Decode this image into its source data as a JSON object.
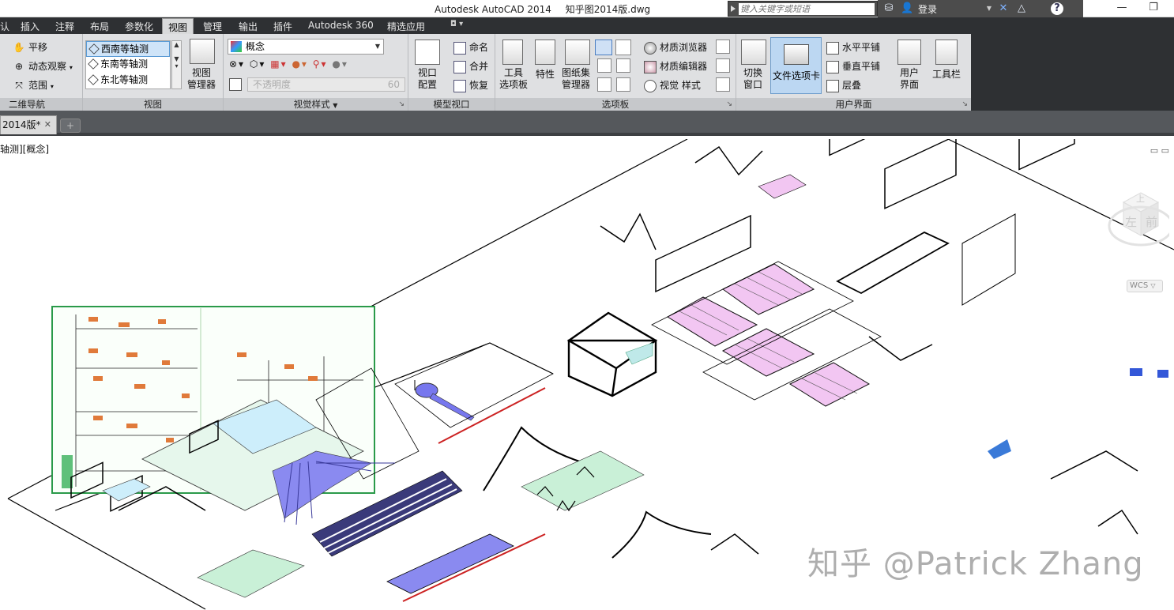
{
  "titlebar": {
    "app": "Autodesk AutoCAD 2014",
    "file": "知乎图2014版.dwg",
    "search_placeholder": "键入关键字或短语",
    "login": "登录"
  },
  "tabs": [
    "认",
    "插入",
    "注释",
    "布局",
    "参数化",
    "视图",
    "管理",
    "输出",
    "插件",
    "Autodesk 360",
    "精选应用"
  ],
  "active_tab": "视图",
  "panels": {
    "nav": {
      "title": "二维导航",
      "pan": "平移",
      "orbit": "动态观察",
      "extents": "范围"
    },
    "views": {
      "title": "视图",
      "items": [
        "西南等轴测",
        "东南等轴测",
        "东北等轴测"
      ],
      "selected": "西南等轴测",
      "manager": "视图\n管理器"
    },
    "visual": {
      "title": "视觉样式",
      "style": "概念",
      "opacity_label": "不透明度",
      "opacity_value": "60"
    },
    "viewports": {
      "title": "模型视口",
      "config": "视口\n配置",
      "named": "命名",
      "join": "合并",
      "restore": "恢复"
    },
    "palettes": {
      "title": "选项板",
      "tool": "工具\n选项板",
      "props": "特性",
      "sheetset": "图纸集\n管理器",
      "mat_browser": "材质浏览器",
      "mat_editor": "材质编辑器",
      "vis_styles": "视觉 样式"
    },
    "ui": {
      "title": "用户界面",
      "switch": "切换\n窗口",
      "filetabs": "文件选项卡",
      "tile_h": "水平平铺",
      "tile_v": "垂直平铺",
      "cascade": "层叠",
      "user_ui": "用户\n界面",
      "toolbars": "工具栏"
    }
  },
  "doc_tab": "2014版*",
  "viewport_label": "轴测][概念]",
  "viewcube": {
    "top": "上",
    "left": "左",
    "front": "前"
  },
  "wcs": "WCS",
  "watermark": "知乎 @Patrick Zhang",
  "colors": {
    "ribbon_bg": "#dfe0e2",
    "tab_bar": "#2e3033",
    "active_button": "#bcd7f2",
    "drawing_magenta": "#f2c6f2",
    "drawing_blue": "#7a7af0",
    "drawing_green_frame": "#2a9a4a"
  }
}
